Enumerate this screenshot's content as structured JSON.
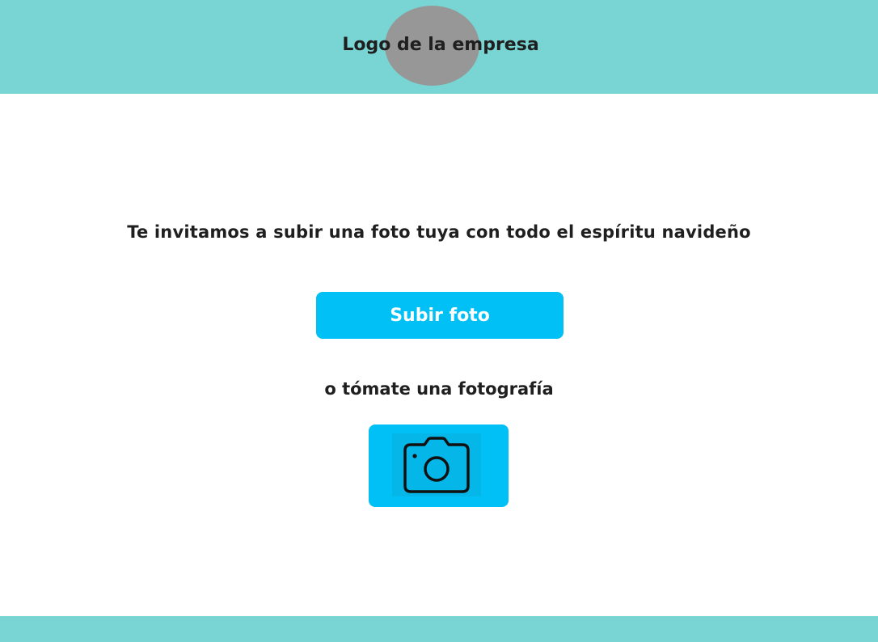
{
  "header": {
    "logo_text": "Logo de la empresa"
  },
  "main": {
    "invitation": "Te invitamos a subir una foto tuya con todo el espíritu navideño",
    "upload_label": "Subir foto",
    "alternative": "o tómate una fotografía",
    "camera_icon": "camera-icon"
  },
  "colors": {
    "header_bg": "#78d5d3",
    "footer_bg": "#78d5d3",
    "accent": "#00c0f5",
    "logo_placeholder": "#979797",
    "text": "#1f1f1f"
  }
}
